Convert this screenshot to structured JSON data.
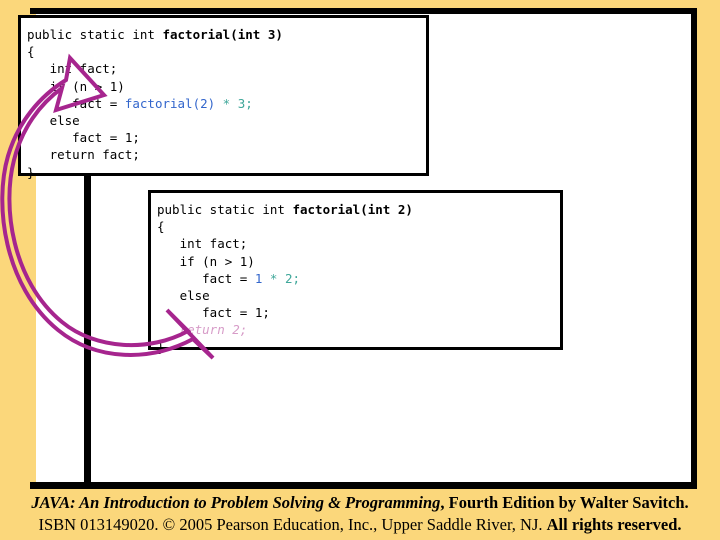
{
  "slide": {
    "background_color": "#FBD77B",
    "panel_color": "#ffffff",
    "border_color": "#000000",
    "arrow_color": "#A6258E"
  },
  "code_box_outer": {
    "title_plain": "public static int ",
    "title_bold": "factorial(int 3)",
    "lines": [
      {
        "text": "{"
      },
      {
        "text": "   int fact;"
      },
      {
        "text": "   if (n > 1)"
      },
      {
        "text": "      fact = ",
        "blue": "factorial(2)",
        "teal": " * 3;"
      },
      {
        "text": "   else"
      },
      {
        "text": "      fact = 1;"
      },
      {
        "text": "   return fact;"
      },
      {
        "text": "}"
      }
    ]
  },
  "code_box_inner": {
    "title_plain": "public static int ",
    "title_bold": "factorial(int 2)",
    "lines": [
      {
        "text": "{"
      },
      {
        "text": "   int fact;"
      },
      {
        "text": "   if (n > 1)"
      },
      {
        "text": "      fact = ",
        "blue": "1",
        "teal": " * 2;"
      },
      {
        "text": "   else"
      },
      {
        "text": "      fact = 1;"
      },
      {
        "text": "   ",
        "faded": "return 2;"
      },
      {
        "text": "}"
      }
    ]
  },
  "arrow": {
    "label": "return-value-flow-arrow",
    "from": "return 2; in factorial(int 2)",
    "to": "fact = factorial(2) * 3; in factorial(int 3)",
    "color": "#A6258E"
  },
  "footer": {
    "line1_italic": "JAVA: An Introduction to Problem Solving & Programming",
    "line1_rest": ", Fourth Edition by Walter Savitch.",
    "line2_a": "ISBN 013149020. © 2005 Pearson Education, Inc., Upper Saddle River, NJ. ",
    "line2_b": "All rights reserved."
  }
}
